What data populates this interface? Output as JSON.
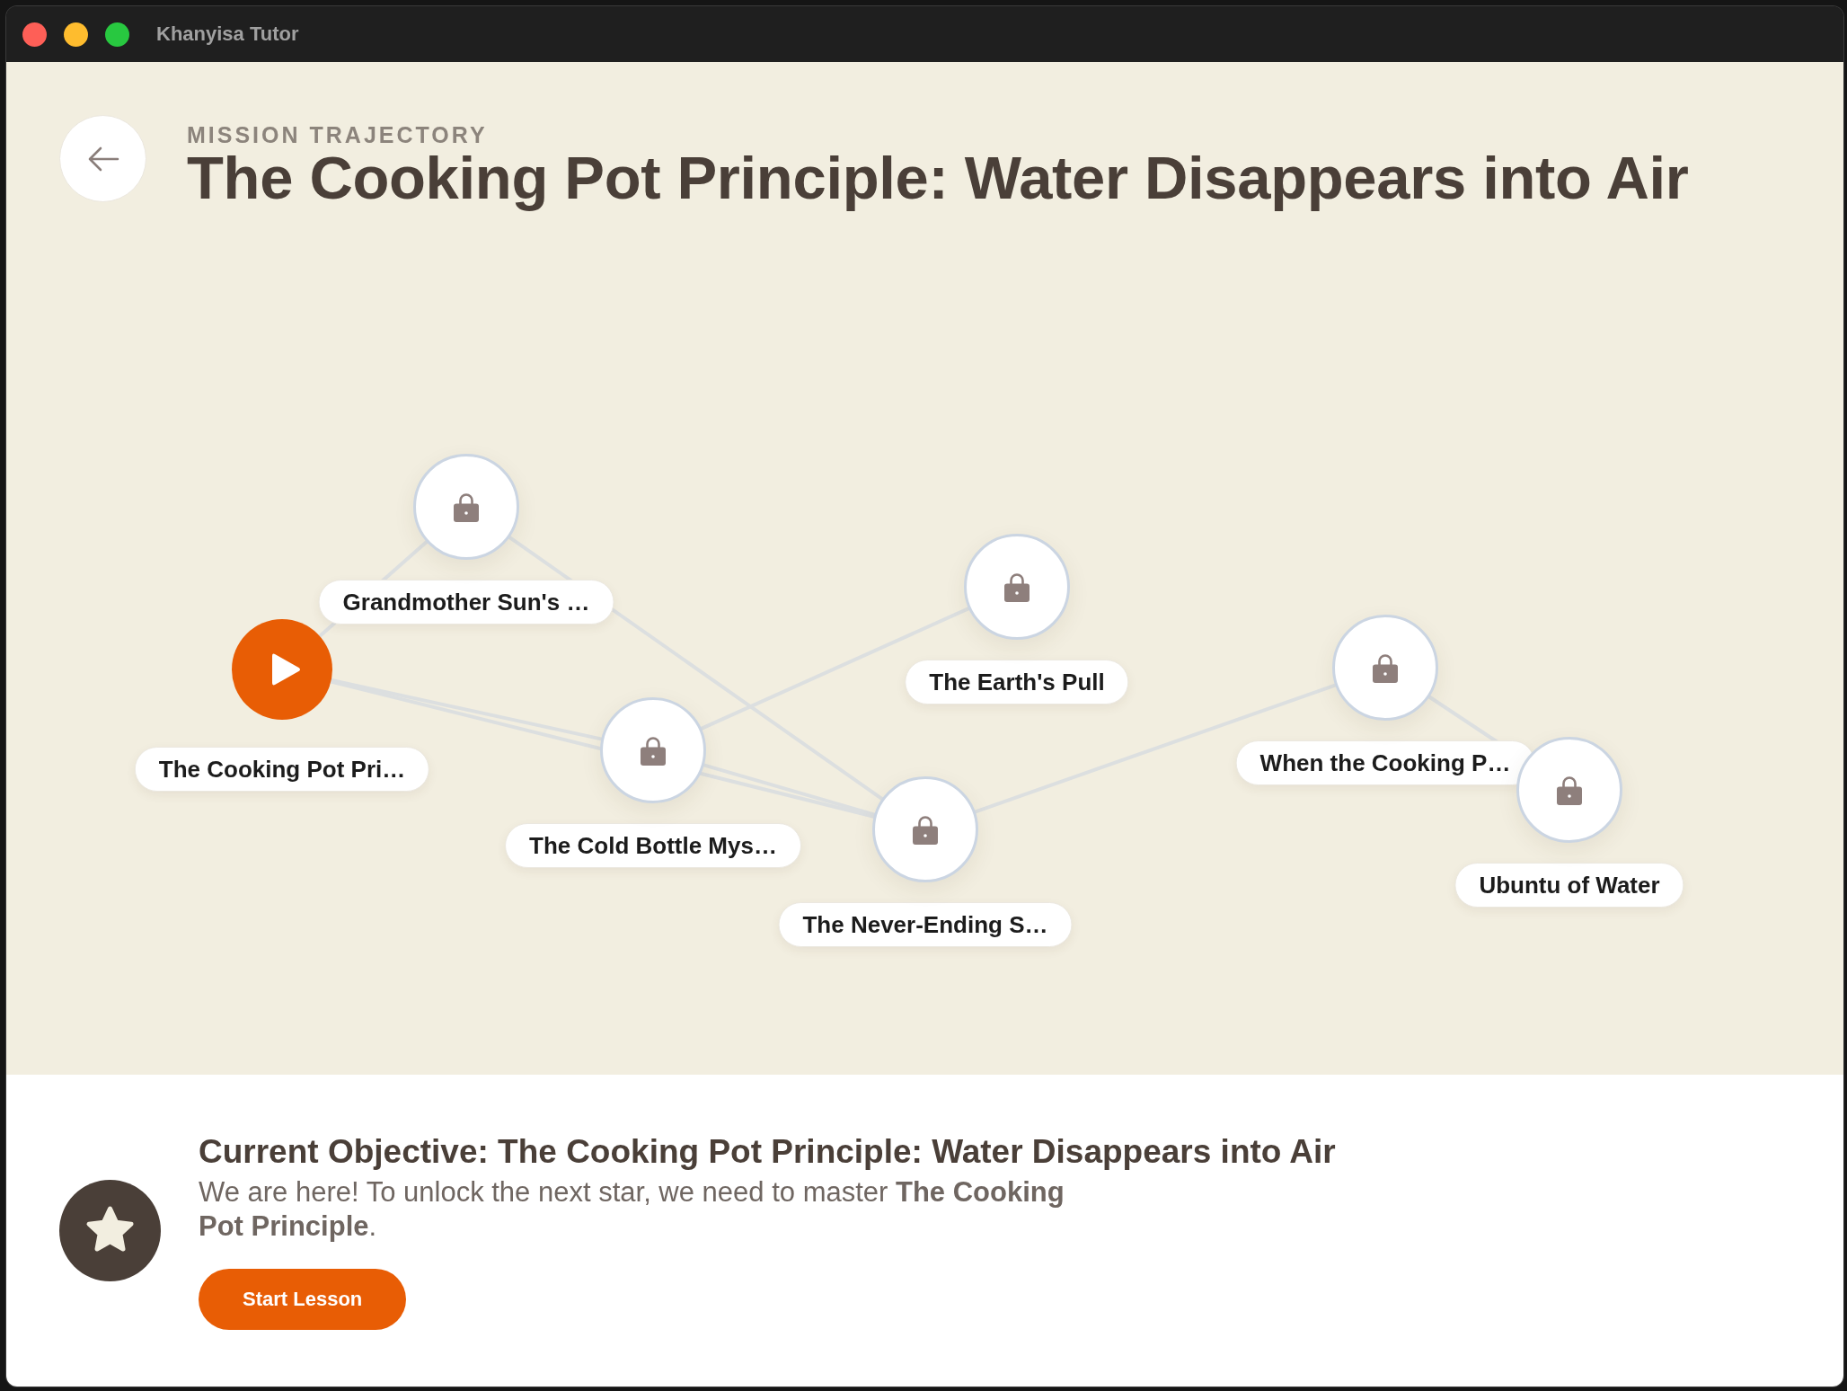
{
  "window": {
    "title": "Khanyisa Tutor"
  },
  "header": {
    "eyebrow": "MISSION TRAJECTORY",
    "title": "The Cooking Pot Principle: Water Disappears into Air"
  },
  "map": {
    "nodes": [
      {
        "label": "The Cooking Pot Pri…",
        "locked": false
      },
      {
        "label": "Grandmother Sun's …",
        "locked": true
      },
      {
        "label": "The Cold Bottle Mys…",
        "locked": true
      },
      {
        "label": "The Earth's Pull",
        "locked": true
      },
      {
        "label": "The Never-Ending S…",
        "locked": true
      },
      {
        "label": "When the Cooking P…",
        "locked": true
      },
      {
        "label": "Ubuntu of Water",
        "locked": true
      }
    ]
  },
  "objective": {
    "heading": "Current Objective: The Cooking Pot Principle: Water Disappears into Air",
    "text": "We are here! To unlock the next star, we need to master **The Cooking Pot Principle**.",
    "button": "Start Lesson"
  }
}
